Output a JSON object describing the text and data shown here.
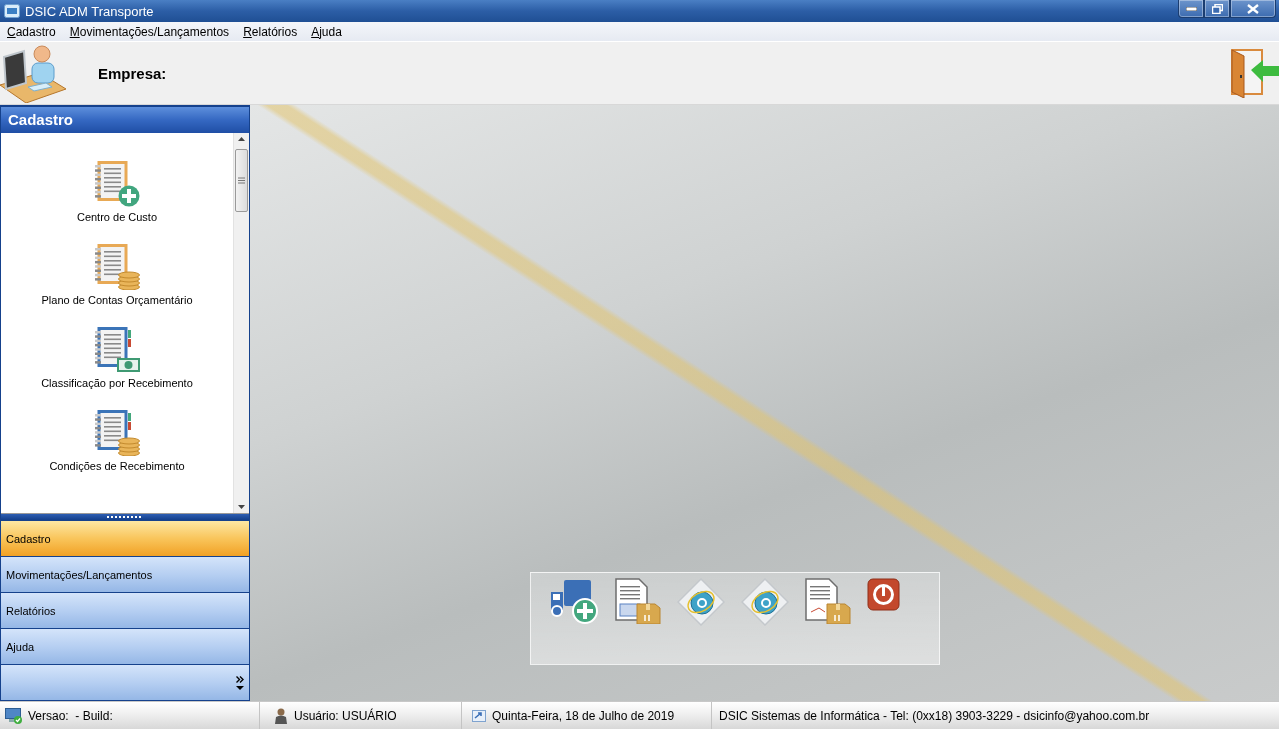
{
  "window": {
    "title": "DSIC ADM Transporte"
  },
  "menu": [
    "Cadastro",
    "Movimentações/Lançamentos",
    "Relatórios",
    "Ajuda"
  ],
  "header": {
    "label": "Empresa:"
  },
  "sidebar": {
    "title": "Cadastro",
    "items": [
      "Centro de Custo",
      "Plano de Contas Orçamentário",
      "Classificação por Recebimento",
      "Condições de Recebimento"
    ],
    "nav": [
      {
        "label": "Cadastro",
        "selected": true
      },
      {
        "label": "Movimentações/Lançamentos",
        "selected": false
      },
      {
        "label": "Relatórios",
        "selected": false
      },
      {
        "label": "Ajuda",
        "selected": false
      }
    ]
  },
  "status_bar": {
    "version": "Versao:  - Build:",
    "user": "Usuário: USUÁRIO",
    "date": "Quinta-Feira, 18 de Julho de 2019",
    "company": "DSIC Sistemas de Informática - Tel: (0xx18) 3903-3229 - dsicinfo@yahoo.com.br"
  }
}
